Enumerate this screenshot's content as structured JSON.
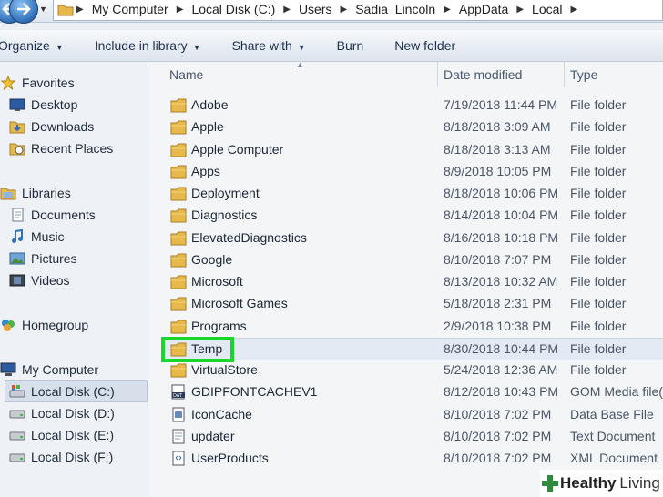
{
  "address": {
    "crumbs": [
      "My Computer",
      "Local Disk (C:)",
      "Users",
      "Sadia  Lincoln",
      "AppData",
      "Local"
    ]
  },
  "toolbar": {
    "organize": "Organize",
    "include": "Include in library",
    "share": "Share with",
    "burn": "Burn",
    "new_folder": "New folder"
  },
  "nav": {
    "favorites": "Favorites",
    "desktop": "Desktop",
    "downloads": "Downloads",
    "recent": "Recent Places",
    "libraries": "Libraries",
    "documents": "Documents",
    "music": "Music",
    "pictures": "Pictures",
    "videos": "Videos",
    "homegroup": "Homegroup",
    "computer": "My Computer",
    "disk_c": "Local Disk (C:)",
    "disk_d": "Local Disk (D:)",
    "disk_e": "Local Disk (E:)",
    "disk_f": "Local Disk (F:)"
  },
  "columns": {
    "name": "Name",
    "date": "Date modified",
    "type": "Type"
  },
  "files": [
    {
      "name": "Adobe",
      "date": "7/19/2018 11:44 PM",
      "type": "File folder",
      "icon": "folder-icon"
    },
    {
      "name": "Apple",
      "date": "8/18/2018 3:09 AM",
      "type": "File folder",
      "icon": "folder-icon"
    },
    {
      "name": "Apple Computer",
      "date": "8/18/2018 3:13 AM",
      "type": "File folder",
      "icon": "folder-icon"
    },
    {
      "name": "Apps",
      "date": "8/9/2018 10:05 PM",
      "type": "File folder",
      "icon": "folder-icon"
    },
    {
      "name": "Deployment",
      "date": "8/18/2018 10:06 PM",
      "type": "File folder",
      "icon": "folder-icon"
    },
    {
      "name": "Diagnostics",
      "date": "8/14/2018 10:04 PM",
      "type": "File folder",
      "icon": "folder-icon"
    },
    {
      "name": "ElevatedDiagnostics",
      "date": "8/16/2018 10:18 PM",
      "type": "File folder",
      "icon": "folder-icon"
    },
    {
      "name": "Google",
      "date": "8/10/2018 7:07 PM",
      "type": "File folder",
      "icon": "folder-icon"
    },
    {
      "name": "Microsoft",
      "date": "8/13/2018 10:32 AM",
      "type": "File folder",
      "icon": "folder-icon"
    },
    {
      "name": "Microsoft Games",
      "date": "5/18/2018 2:31 PM",
      "type": "File folder",
      "icon": "folder-icon"
    },
    {
      "name": "Programs",
      "date": "2/9/2018 10:38 PM",
      "type": "File folder",
      "icon": "folder-icon"
    },
    {
      "name": "Temp",
      "date": "8/30/2018 10:44 PM",
      "type": "File folder",
      "icon": "folder-icon"
    },
    {
      "name": "VirtualStore",
      "date": "5/24/2018 12:36 AM",
      "type": "File folder",
      "icon": "folder-icon"
    },
    {
      "name": "GDIPFONTCACHEV1",
      "date": "8/12/2018 10:43 PM",
      "type": "GOM Media file(",
      "icon": "dat-file-icon"
    },
    {
      "name": "IconCache",
      "date": "8/10/2018 7:02 PM",
      "type": "Data Base File",
      "icon": "db-file-icon"
    },
    {
      "name": "updater",
      "date": "8/10/2018 7:02 PM",
      "type": "Text Document",
      "icon": "text-file-icon"
    },
    {
      "name": "UserProducts",
      "date": "8/10/2018 7:02 PM",
      "type": "XML Document",
      "icon": "xml-file-icon"
    }
  ],
  "watermark": {
    "brand": "Healthy",
    "word": "Living"
  },
  "colors": {
    "highlight": "#19d62a",
    "folder": "#e6b94a"
  }
}
